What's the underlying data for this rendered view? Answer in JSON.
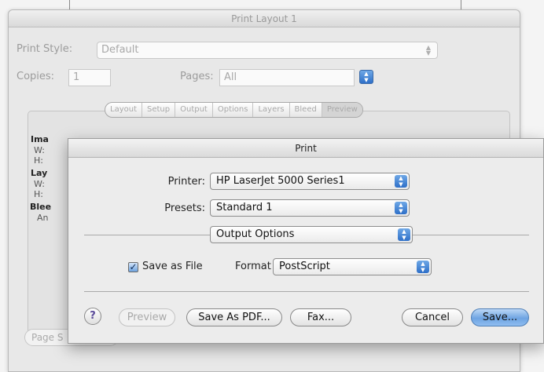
{
  "back_window": {
    "title": "Print Layout 1",
    "print_style_label": "Print Style:",
    "print_style_value": "Default",
    "copies_label": "Copies:",
    "copies_value": "1",
    "pages_label": "Pages:",
    "pages_value": "All",
    "tabs": [
      "Layout",
      "Setup",
      "Output",
      "Options",
      "Layers",
      "Bleed",
      "Preview"
    ],
    "side_labels": [
      "Ima",
      "W:",
      "H:",
      "Lay",
      "W:",
      "H:",
      "Blee",
      "An"
    ],
    "page_setup_label": "Page S"
  },
  "print_sheet": {
    "title": "Print",
    "printer_label": "Printer:",
    "printer_value": "HP LaserJet 5000 Series1",
    "presets_label": "Presets:",
    "presets_value": "Standard 1",
    "pane_value": "Output Options",
    "save_as_file_label": "Save as File",
    "save_as_file_checked": true,
    "format_label": "Format",
    "format_value": "PostScript",
    "help_label": "?",
    "preview_label": "Preview",
    "save_as_pdf_label": "Save As PDF...",
    "fax_label": "Fax...",
    "cancel_label": "Cancel",
    "save_label": "Save..."
  },
  "icons": {
    "popup_arrows": "up-down-arrows-icon",
    "checkmark": "checkmark-icon",
    "help": "question-mark-icon"
  },
  "colors": {
    "accent_blue": "#2e6fc8",
    "default_button": "#6ea4e2",
    "help_glyph": "#5a4a9a"
  }
}
